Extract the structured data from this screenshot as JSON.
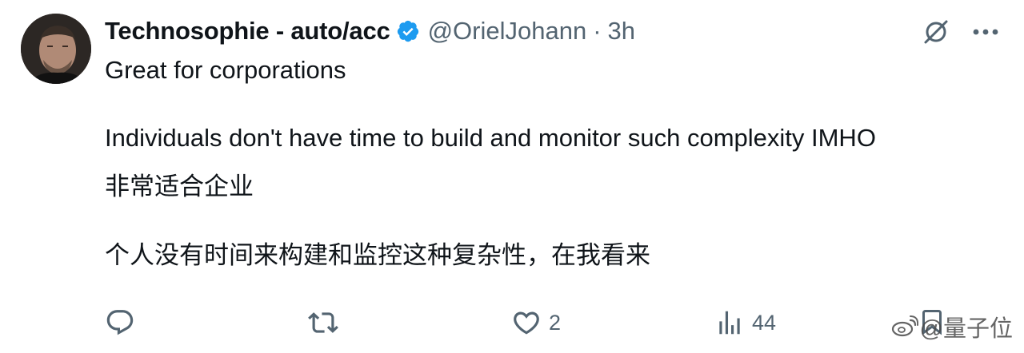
{
  "author": {
    "display_name": "Technosophie - auto/acc",
    "handle": "@OrielJohann",
    "separator": "·",
    "time": "3h",
    "verified_color": "#1d9bf0"
  },
  "top_actions": {
    "grok_icon": "grok-slash-icon",
    "more_icon": "more-dots-icon"
  },
  "tweet": {
    "line1": "Great for corporations",
    "line2": "Individuals don't have time to build and monitor such complexity IMHO",
    "translation_line1": "非常适合企业",
    "translation_line2": "个人没有时间来构建和监控这种复杂性，在我看来"
  },
  "actions": {
    "reply": {
      "icon": "reply-icon",
      "count": ""
    },
    "repost": {
      "icon": "repost-icon",
      "count": ""
    },
    "like": {
      "icon": "heart-icon",
      "count": "2"
    },
    "views": {
      "icon": "views-icon",
      "count": "44"
    },
    "bookmark": {
      "icon": "bookmark-icon",
      "count": ""
    }
  },
  "watermark": {
    "text": "@量子位",
    "logo": "weibo-icon"
  },
  "colors": {
    "text": "#0f1419",
    "secondary": "#536471",
    "accent": "#1d9bf0"
  }
}
